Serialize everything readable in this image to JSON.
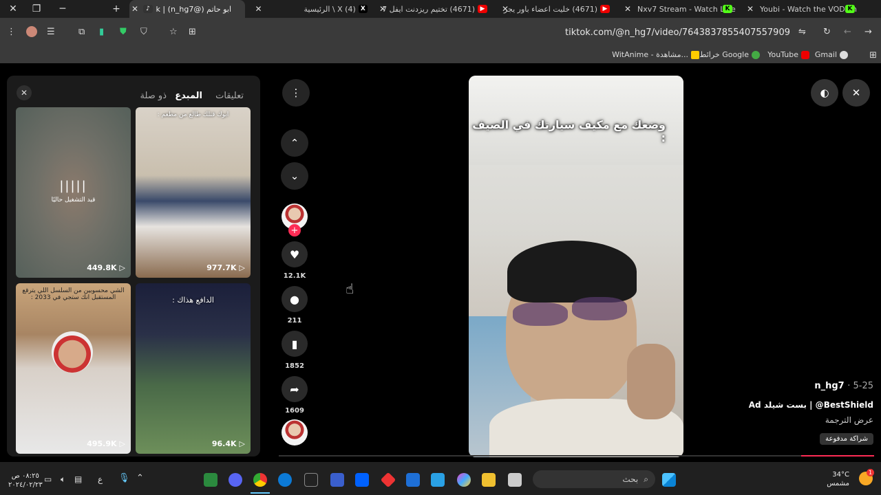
{
  "window": {
    "tabs": [
      {
        "title": "ابو حاتم (@n_hg7) | TikTok",
        "active": true
      },
      {
        "title": "(4) X \\ الرئيسية",
        "active": false
      },
      {
        "title": "(4671) تختيم ريزدنت ايفل 7",
        "active": false
      },
      {
        "title": "(4671) خليت اعضاء باور يجر",
        "active": false
      },
      {
        "title": "Nxv7 Stream - Watch Live",
        "active": false
      },
      {
        "title": "Youbi - Watch the VOD on",
        "active": false
      }
    ]
  },
  "address": {
    "url": "tiktok.com/@n_hg7/video/7643837855407557909"
  },
  "bookmarks": [
    "Gmail",
    "YouTube",
    "خرائط Google",
    "WitAnime - مشاهدة..."
  ],
  "panel": {
    "tabs": [
      "تعليقات",
      "المبدع",
      "ذو صلة"
    ],
    "active_tab": "المبدع",
    "thumbs": [
      {
        "caption": "قيد التشغيل حاليًا",
        "count": "449.8K"
      },
      {
        "caption": "ابوك قتلك طالع من مطعم :",
        "count": "977.7K"
      },
      {
        "caption": "الشي محسوبين من السلسل اللي يترقع المستقبل انك ستجي في 2033 :",
        "count": "495.9K"
      },
      {
        "caption": "الدافع هذاك :",
        "count": "96.4K"
      }
    ]
  },
  "actions": {
    "likes": "12.1K",
    "comments": "211",
    "saves": "1852",
    "shares": "1609"
  },
  "video": {
    "caption": "وضعك مع مكيف سيارتك في الصيف :",
    "author": "n_hg7",
    "date": "5-25",
    "description": "BestShield@ | بست شيلد Ad",
    "translate": "عرض الترجمة",
    "badge": "شراكة مدفوعة"
  },
  "taskbar": {
    "search": "بحث",
    "weather_temp": "34°C",
    "weather_desc": "مشمس",
    "time": "٠٨:٢٥ ص",
    "date": "٢٠٢٤/٠٢/٢٣",
    "lang": "ع"
  }
}
